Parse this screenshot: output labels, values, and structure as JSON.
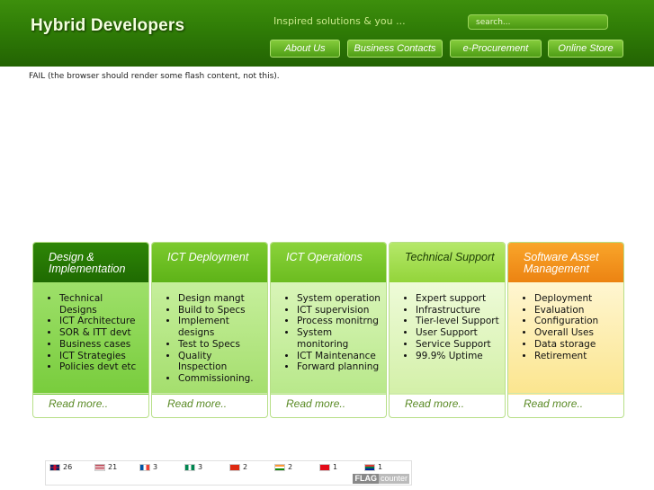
{
  "header": {
    "brand": "Hybrid Developers",
    "tagline": "Inspired solutions & you ...",
    "search_placeholder": "search...",
    "nav": [
      "About Us",
      "Business Contacts",
      "e-Procurement",
      "Online Store"
    ]
  },
  "notice": "FAIL (the browser should render some flash content, not this).",
  "columns": [
    {
      "title": "Design & Implementation",
      "items": [
        "Technical Designs",
        "ICT Architecture",
        "SOR & ITT devt",
        "Business cases",
        "ICT Strategies",
        "Policies devt etc"
      ],
      "link": "Read more.."
    },
    {
      "title": "ICT Deployment",
      "items": [
        "Design mangt",
        "Build to Specs",
        "Implement designs",
        "Test to Specs",
        "Quality Inspection",
        "Commissioning."
      ],
      "link": "Read more.."
    },
    {
      "title": "ICT Operations",
      "items": [
        "System operation",
        "ICT supervision",
        "Process monitrng",
        "System monitoring",
        "ICT Maintenance",
        "Forward planning"
      ],
      "link": "Read more.."
    },
    {
      "title": "Technical Support",
      "items": [
        "Expert support",
        "Infrastructure",
        "Tier-level Support",
        "User Support",
        "Service Support",
        "99.9% Uptime"
      ],
      "link": "Read more.."
    },
    {
      "title": "Software Asset Management",
      "items": [
        "Deployment",
        "Evaluation",
        "Configuration",
        "Overall Uses",
        "Data storage",
        "Retirement"
      ],
      "link": "Read more.."
    }
  ],
  "flag_counter": {
    "entries": [
      {
        "flag": "uk-flag-icon",
        "count": "26"
      },
      {
        "flag": "us-flag-icon",
        "count": "21"
      },
      {
        "flag": "france-flag-icon",
        "count": "3"
      },
      {
        "flag": "nigeria-flag-icon",
        "count": "3"
      },
      {
        "flag": "china-flag-icon",
        "count": "2"
      },
      {
        "flag": "india-flag-icon",
        "count": "2"
      },
      {
        "flag": "turkey-flag-icon",
        "count": "1"
      },
      {
        "flag": "south-africa-flag-icon",
        "count": "1"
      }
    ],
    "logo_a": "FLAG",
    "logo_b": "counter"
  }
}
